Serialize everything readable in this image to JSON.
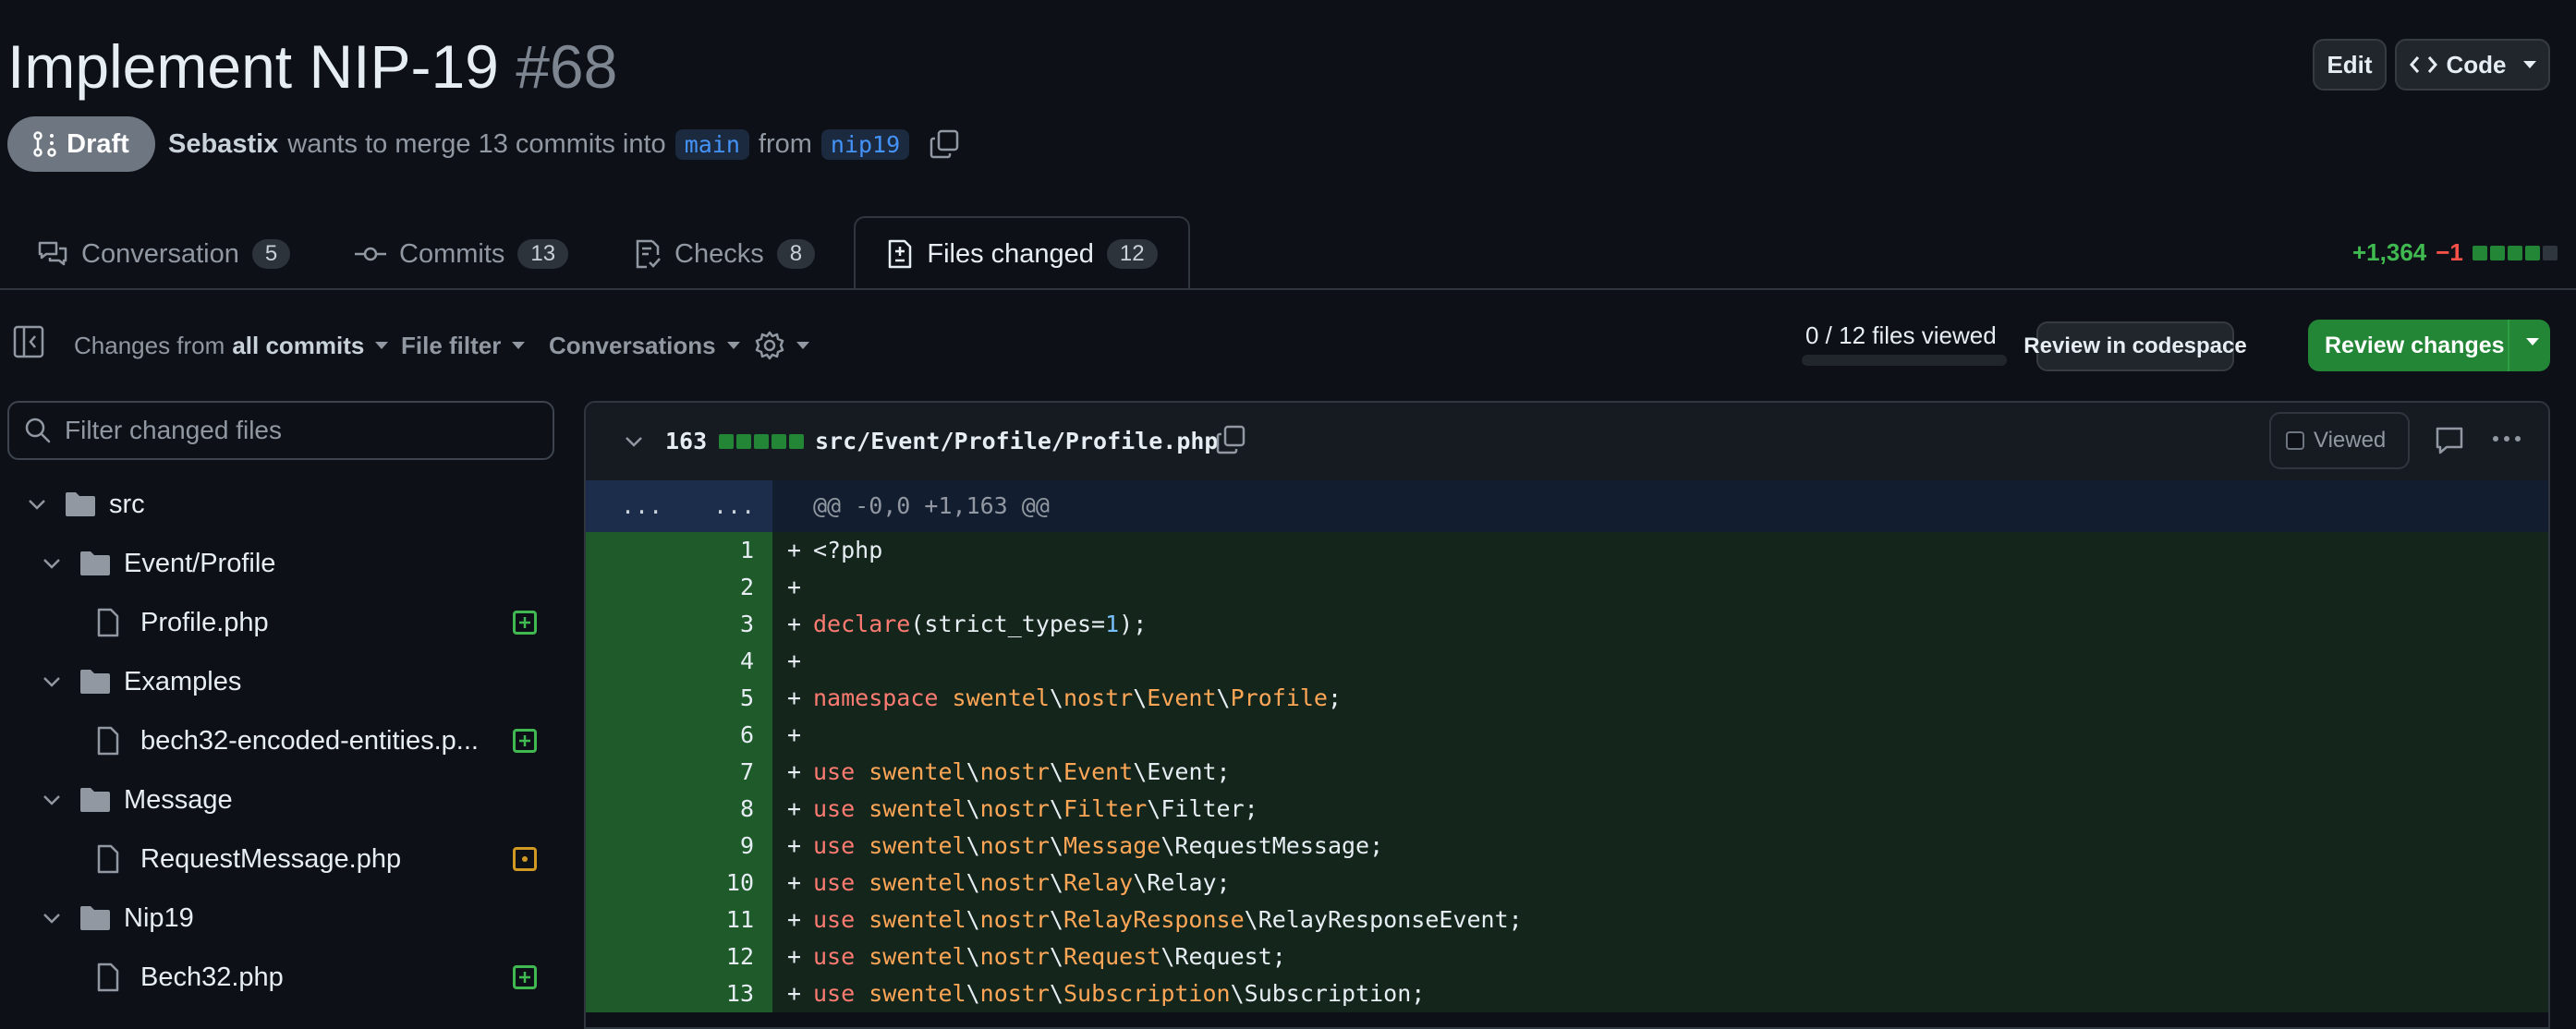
{
  "pr": {
    "title": "Implement NIP-19",
    "number": "#68",
    "status": "Draft",
    "author": "Sebastix",
    "merge_text": "wants to merge 13 commits into",
    "base_branch": "main",
    "from_text": "from",
    "head_branch": "nip19"
  },
  "header_buttons": {
    "edit": "Edit",
    "code": "Code"
  },
  "tabs": [
    {
      "label": "Conversation",
      "count": "5"
    },
    {
      "label": "Commits",
      "count": "13"
    },
    {
      "label": "Checks",
      "count": "8"
    },
    {
      "label": "Files changed",
      "count": "12"
    }
  ],
  "diffstat": {
    "additions": "+1,364",
    "deletions": "−1"
  },
  "toolbar": {
    "changes_from": "Changes from",
    "changes_from_value": "all commits",
    "file_filter": "File filter",
    "conversations": "Conversations",
    "files_viewed": "0 / 12 files viewed",
    "review_codespace": "Review in codespace",
    "review_changes": "Review changes"
  },
  "sidebar": {
    "filter_placeholder": "Filter changed files",
    "tree": [
      {
        "type": "folder",
        "label": "src"
      },
      {
        "type": "folder",
        "label": "Event/Profile"
      },
      {
        "type": "file",
        "label": "Profile.php",
        "status": "added"
      },
      {
        "type": "folder",
        "label": "Examples"
      },
      {
        "type": "file",
        "label": "bech32-encoded-entities.p...",
        "status": "added"
      },
      {
        "type": "folder",
        "label": "Message"
      },
      {
        "type": "file",
        "label": "RequestMessage.php",
        "status": "modified"
      },
      {
        "type": "folder",
        "label": "Nip19"
      },
      {
        "type": "file",
        "label": "Bech32.php",
        "status": "added"
      }
    ]
  },
  "diff_file": {
    "count": "163",
    "path": "src/Event/Profile/Profile.php",
    "viewed_label": "Viewed",
    "hunk_left": "...",
    "hunk_right": "...",
    "hunk_header": "@@ -0,0 +1,163 @@",
    "line_numbers": [
      "1",
      "2",
      "3",
      "4",
      "5",
      "6",
      "7",
      "8",
      "9",
      "10",
      "11",
      "12",
      "13"
    ]
  },
  "code": {
    "l1": "<?php",
    "l3_kw": "declare",
    "l3_a": "(strict_types=",
    "l3_num": "1",
    "l3_b": ");",
    "l5_kw": "namespace",
    "l5_a": "swentel",
    "l5_b": "nostr",
    "l5_c": "Event",
    "l5_d": "Profile",
    "l5_e": ";",
    "use": "use",
    "uses": [
      {
        "a": "swentel",
        "b": "nostr",
        "c": "Event",
        "d": "Event;"
      },
      {
        "a": "swentel",
        "b": "nostr",
        "c": "Filter",
        "d": "Filter;"
      },
      {
        "a": "swentel",
        "b": "nostr",
        "c": "Message",
        "d": "RequestMessage;"
      },
      {
        "a": "swentel",
        "b": "nostr",
        "c": "Relay",
        "d": "Relay;"
      },
      {
        "a": "swentel",
        "b": "nostr",
        "c": "RelayResponse",
        "d": "RelayResponseEvent;"
      },
      {
        "a": "swentel",
        "b": "nostr",
        "c": "Request",
        "d": "Request;"
      },
      {
        "a": "swentel",
        "b": "nostr",
        "c": "Subscription",
        "d": "Subscription;"
      }
    ]
  },
  "colors": {
    "accent_green": "#238636",
    "add_text": "#3fb950",
    "del_text": "#f85149",
    "link_blue": "#4493f8",
    "modified": "#d29922"
  }
}
